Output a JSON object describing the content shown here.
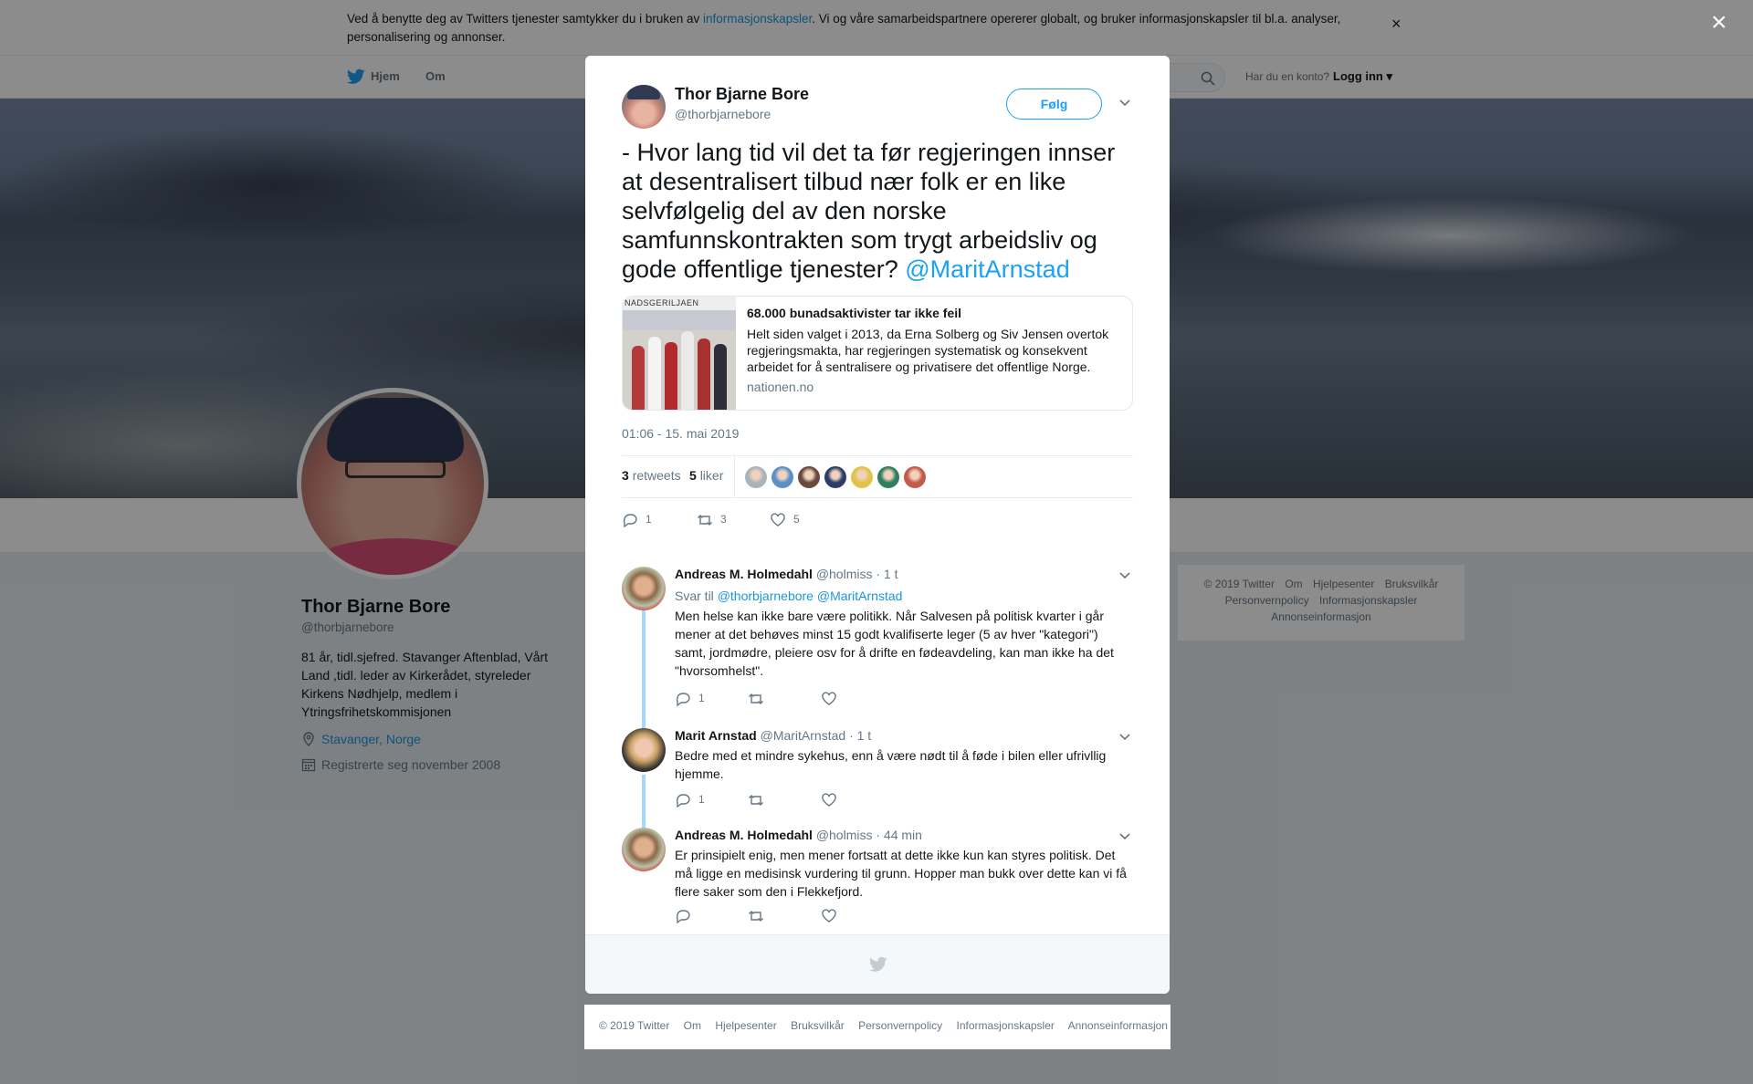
{
  "cookie": {
    "text_before": "Ved å benytte deg av Twitters tjenester samtykker du i bruken av ",
    "link": "informasjonskapsler",
    "text_after": ". Vi og våre samarbeidspartnere opererer globalt, og bruker informasjonskapsler til bl.a. analyser, personalisering og annonser.",
    "close": "×"
  },
  "nav": {
    "home": "Hjem",
    "about": "Om",
    "have_account": "Har du en konto?",
    "login": "Logg inn"
  },
  "profile": {
    "name": "Thor Bjarne Bore",
    "handle": "@thorbjarnebore",
    "bio": "81 år, tidl.sjefred. Stavanger Aftenblad, Vårt Land ,tidl. leder av Kirkerådet, styreleder Kirkens Nødhjelp, medlem i Ytringsfrihetskommisjonen",
    "location": "Stavanger, Norge",
    "registered": "Registrerte seg november 2008"
  },
  "side_footer": [
    "© 2019 Twitter",
    "Om",
    "Hjelpesenter",
    "Bruksvilkår",
    "Personvernpolicy",
    "Informasjonskapsler",
    "Annonseinformasjon"
  ],
  "modal_close": "×",
  "tweet": {
    "author": "Thor Bjarne Bore",
    "handle": "@thorbjarnebore",
    "follow_label": "Følg",
    "text": "- Hvor lang tid vil det ta før regjeringen innser at desentralisert tilbud nær folk er en like selvfølgelig del av den norske samfunnskontrakten som trygt arbeidsliv og gode offentlige tjenester? ",
    "mention": "@MaritArnstad",
    "card": {
      "image_label": "NADSGERILJAEN",
      "title": "68.000 bunadsaktivister tar ikke feil",
      "description": "Helt siden valget i 2013, da Erna Solberg og Siv Jensen overtok regjeringsmakta, har regjeringen systematisk og konsekvent arbeidet for å sentralisere og privatisere det offentlige Norge.",
      "domain": "nationen.no"
    },
    "timestamp": "01:06 - 15. mai 2019",
    "retweets_count": "3",
    "retweets_label": "retweets",
    "likes_count": "5",
    "likes_label": "liker",
    "liker_colors": [
      "#a9b3bb",
      "#5b8fc7",
      "#6b4a3d",
      "#2b3e66",
      "#e3c24a",
      "#2f7f5e",
      "#c45a4a"
    ],
    "actions": {
      "replies": "1",
      "retweets": "3",
      "likes": "5"
    }
  },
  "replies": [
    {
      "name": "Andreas M. Holmedahl",
      "handle": "@holmiss",
      "time": "· 1 t",
      "reply_to_label": "Svar til",
      "reply_to": "@thorbjarnebore @MaritArnstad",
      "text": "Men helse kan ikke bare være politikk. Når Salvesen på politisk kvarter i går mener at det behøves minst 15 godt kvalifiserte leger  (5 av hver \"kategori\") samt, jordmødre, pleiere osv for å drifte en fødeavdeling, kan man ikke ha det \"hvorsomhelst\".",
      "reply_count": "1"
    },
    {
      "name": "Marit Arnstad",
      "handle": "@MaritArnstad",
      "time": "· 1 t",
      "text": "Bedre med et mindre sykehus, enn å være nødt til å føde i bilen eller ufrivllig hjemme.",
      "reply_count": "1"
    },
    {
      "name": "Andreas M. Holmedahl",
      "handle": "@holmiss",
      "time": "· 44 min",
      "text": "Er prinsipielt enig, men mener fortsatt at dette ikke kun kan styres politisk. Det må ligge en medisinsk vurdering til grunn. Hopper man bukk over dette kan vi få flere saker som den i Flekkefjord.",
      "reply_count": ""
    }
  ],
  "bottom_footer": [
    "© 2019 Twitter",
    "Om",
    "Hjelpesenter",
    "Bruksvilkår",
    "Personvernpolicy",
    "Informasjonskapsler",
    "Annonseinformasjon"
  ],
  "colors": {
    "twitter_blue": "#1da1f2",
    "link_blue": "#1b95e0",
    "thread_line": "#a4d9f9"
  }
}
